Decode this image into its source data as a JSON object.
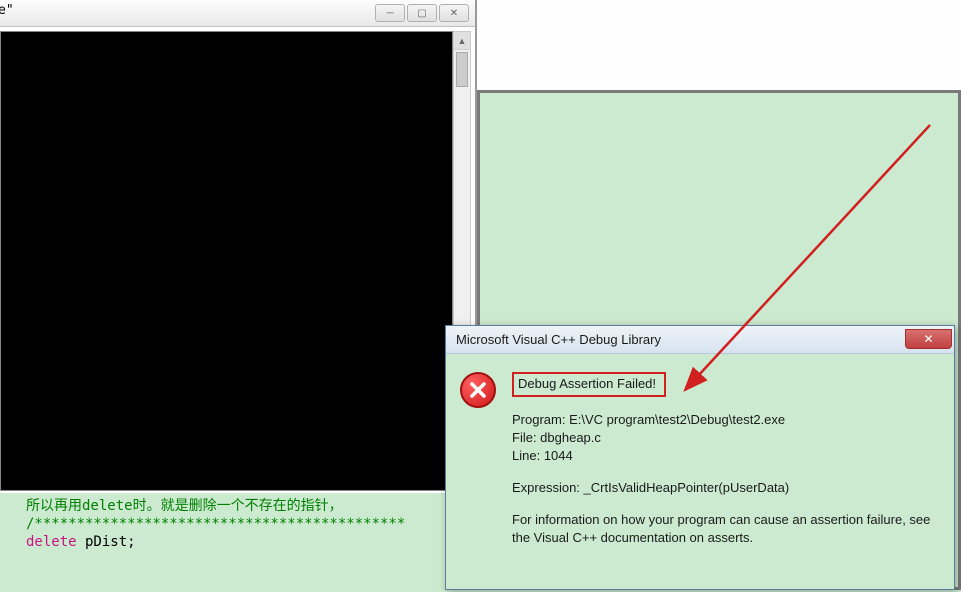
{
  "console": {
    "tab_label": "e\"",
    "minimize_symbol": "─",
    "maximize_symbol": "▢",
    "close_symbol": "✕"
  },
  "code": {
    "line1": "所以再用delete时。就是删除一个不存在的指针，",
    "line2_stars": "/********************************************",
    "line3_delete": "delete",
    "line3_rest": " pDist;"
  },
  "dialog": {
    "title": "Microsoft Visual C++ Debug Library",
    "close_symbol": "✕",
    "heading": "Debug Assertion Failed!",
    "program_label": "Program: ",
    "program_value": "E:\\VC program\\test2\\Debug\\test2.exe",
    "file_label": "File: ",
    "file_value": "dbgheap.c",
    "line_label": "Line: ",
    "line_value": "1044",
    "expression_label": "Expression: ",
    "expression_value": "_CrtIsValidHeapPointer(pUserData)",
    "info_text": "For information on how your program can cause an assertion failure, see the Visual C++ documentation on asserts."
  }
}
